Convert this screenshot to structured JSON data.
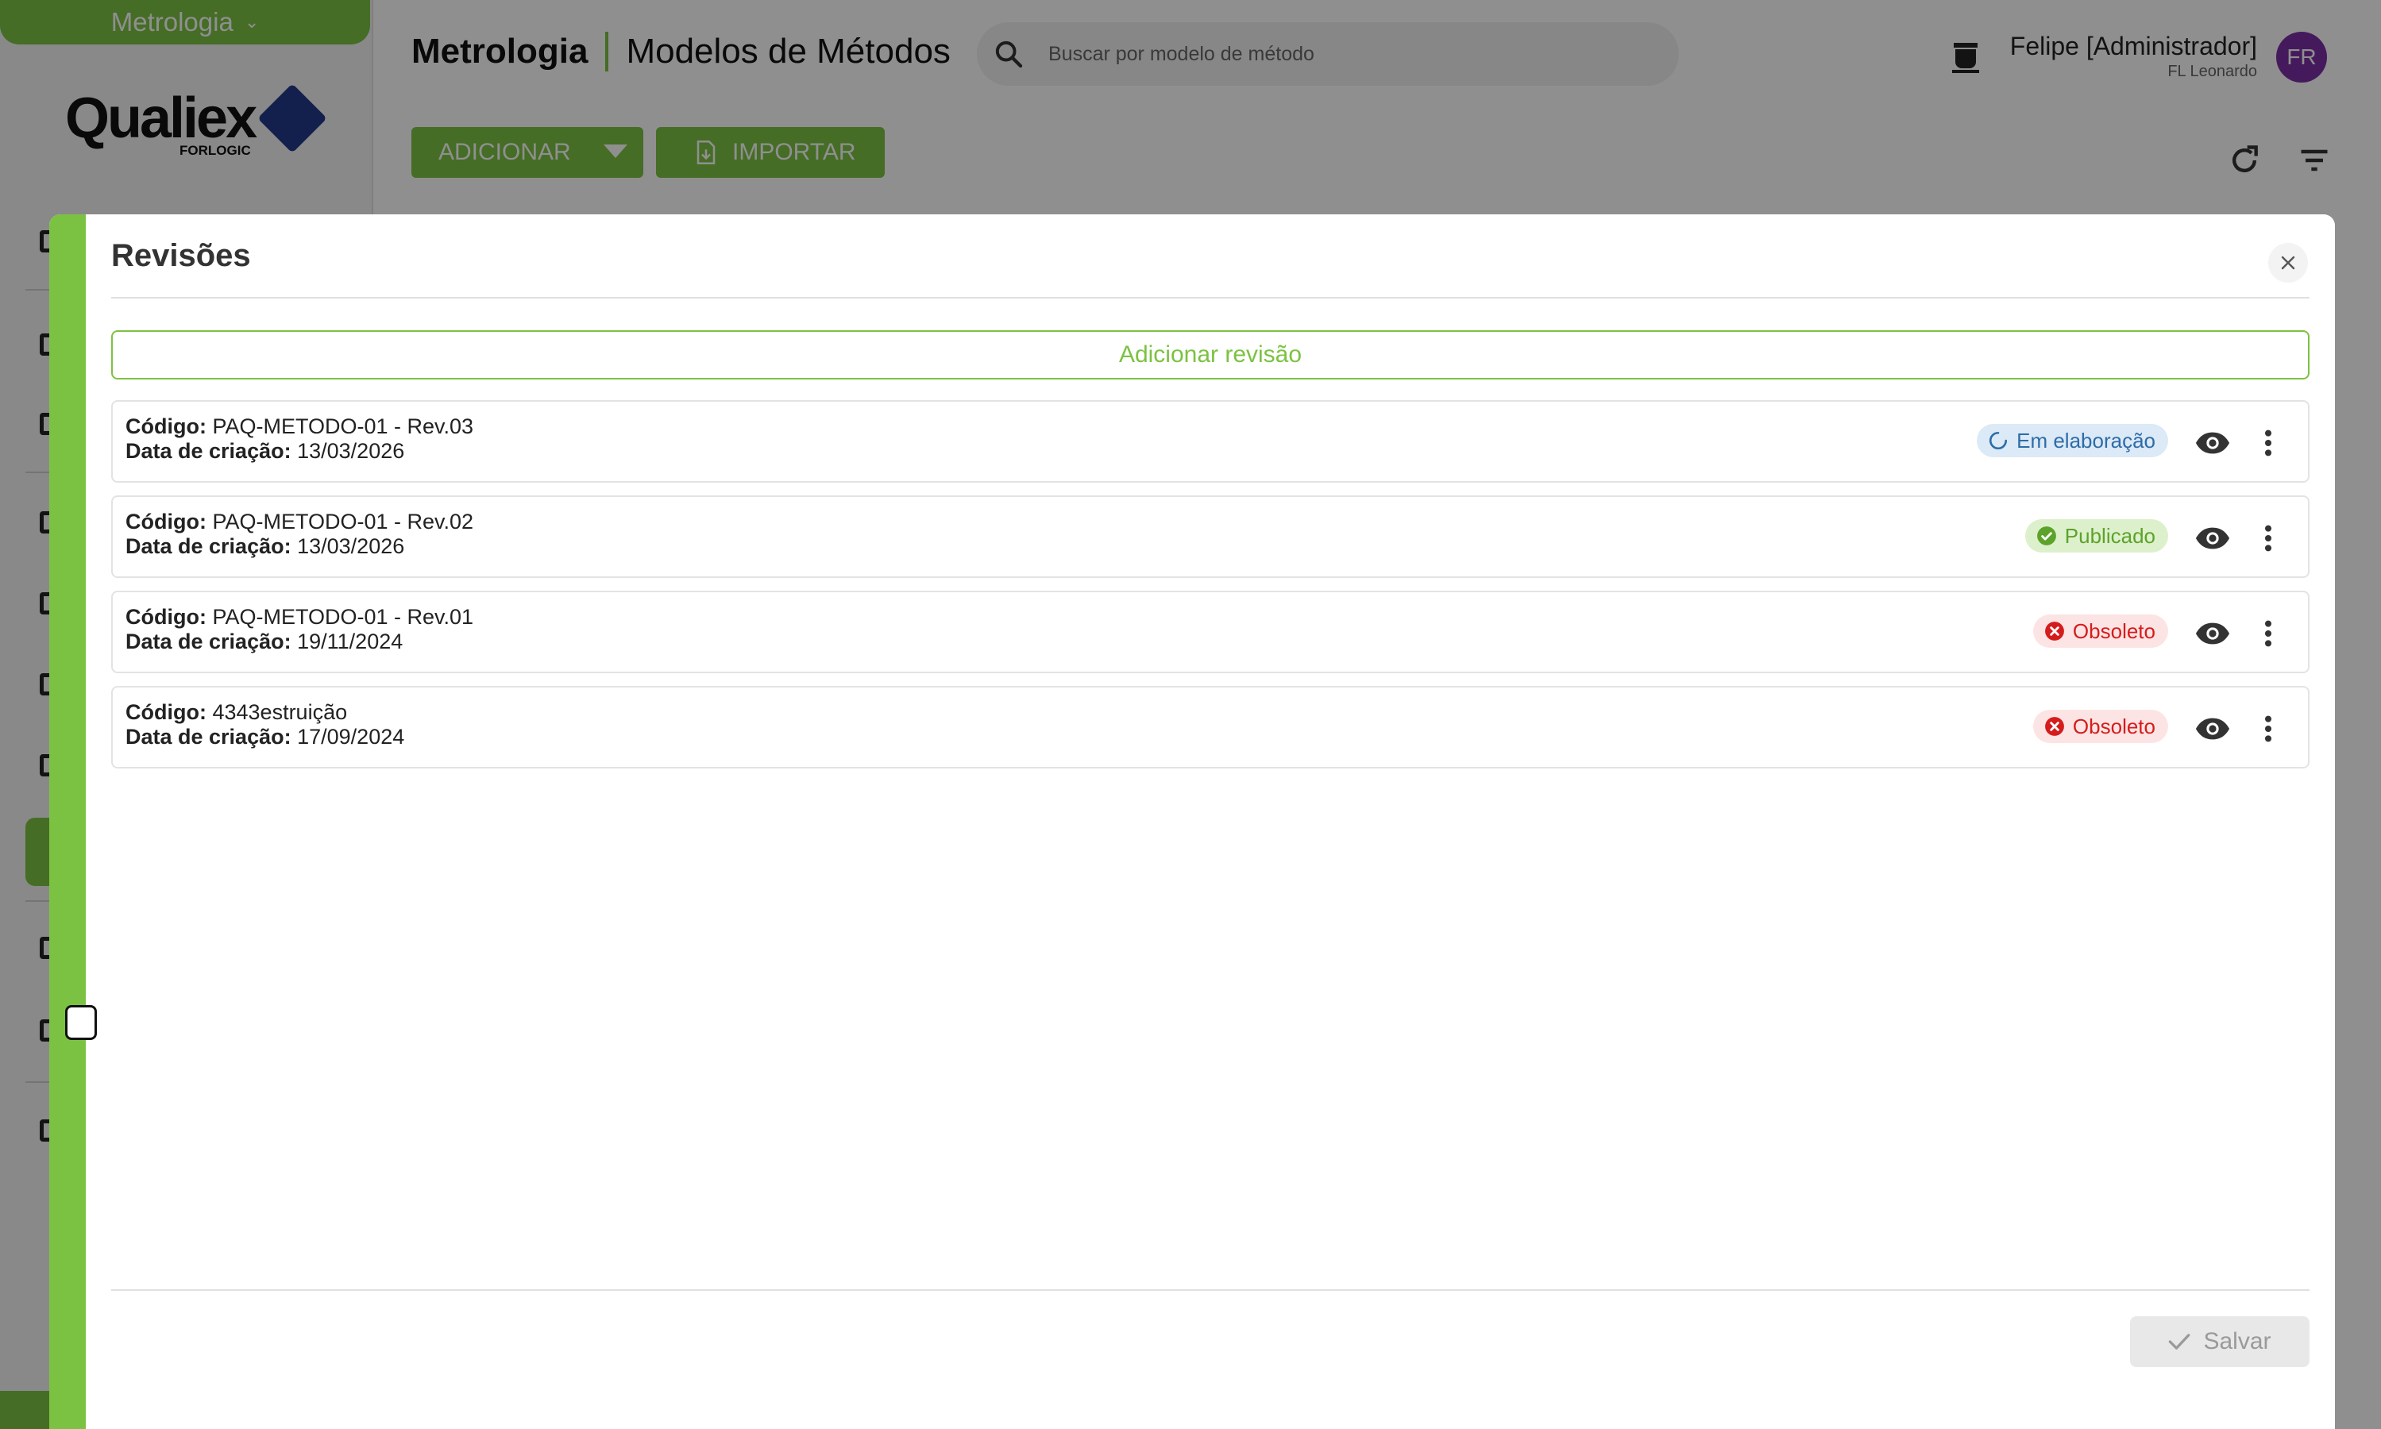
{
  "sidebar": {
    "module_label": "Metrologia",
    "logo_text": "Qualiex",
    "logo_sub": "FORLOGIC"
  },
  "header": {
    "module": "Metrologia",
    "page": "Modelos de Métodos",
    "search_placeholder": "Buscar por modelo de método",
    "user_name": "Felipe [Administrador]",
    "user_org": "FL Leonardo",
    "avatar_initials": "FR",
    "avatar_color": "#7b2fa6"
  },
  "toolbar": {
    "add_label": "ADICIONAR",
    "import_label": "IMPORTAR"
  },
  "dialog": {
    "title": "Revisões",
    "add_revision_label": "Adicionar revisão",
    "save_label": "Salvar",
    "code_label": "Código:",
    "date_label": "Data de criação:",
    "revisions": [
      {
        "code": "PAQ-METODO-01 - Rev.03",
        "created": "13/03/2026",
        "status": "Em elaboração"
      },
      {
        "code": "PAQ-METODO-01 - Rev.02",
        "created": "13/03/2026",
        "status": "Publicado"
      },
      {
        "code": "PAQ-METODO-01 - Rev.01",
        "created": "19/11/2024",
        "status": "Obsoleto"
      },
      {
        "code": "4343estruição",
        "created": "17/09/2024",
        "status": "Obsoleto"
      }
    ]
  },
  "colors": {
    "brand_green": "#7cc242",
    "status_draft": "#2d6ca8",
    "status_published": "#5ca32a",
    "status_obsolete": "#d51c1c"
  }
}
